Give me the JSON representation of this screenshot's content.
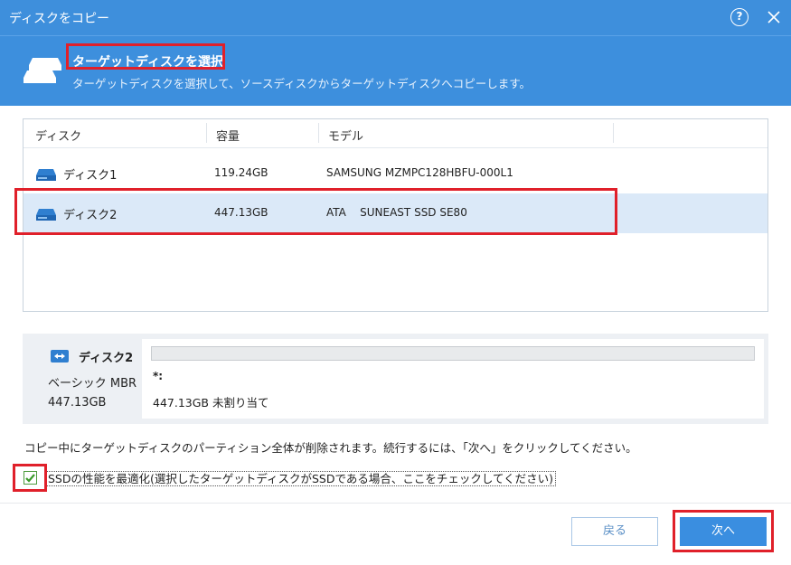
{
  "window": {
    "title": "ディスクをコピー"
  },
  "header": {
    "heading": "ターゲットディスクを選択",
    "subtitle": "ターゲットディスクを選択して、ソースディスクからターゲットディスクへコピーします。"
  },
  "table": {
    "columns": [
      "ディスク",
      "容量",
      "モデル"
    ],
    "rows": [
      {
        "name": "ディスク1",
        "capacity": "119.24GB",
        "model": "SAMSUNG MZMPC128HBFU-000L1",
        "selected": false
      },
      {
        "name": "ディスク2",
        "capacity": "447.13GB",
        "model": "ATA    SUNEAST SSD SE80",
        "selected": true
      }
    ]
  },
  "disk_panel": {
    "name": "ディスク2",
    "type": "ベーシック MBR",
    "size": "447.13GB",
    "partition_label": "*:",
    "partition_info": "447.13GB 未割り当て"
  },
  "warning": "コピー中にターゲットディスクのパーティション全体が削除されます。続行するには、「次へ」をクリックしてください。",
  "ssd_option": {
    "label": "SSDの性能を最適化(選択したターゲットディスクがSSDである場合、ここをチェックしてください)",
    "checked": true
  },
  "buttons": {
    "back": "戻る",
    "next": "次へ"
  },
  "colors": {
    "accent": "#3d8fdd",
    "highlight": "#e0202a",
    "check": "#4b9b3c"
  }
}
